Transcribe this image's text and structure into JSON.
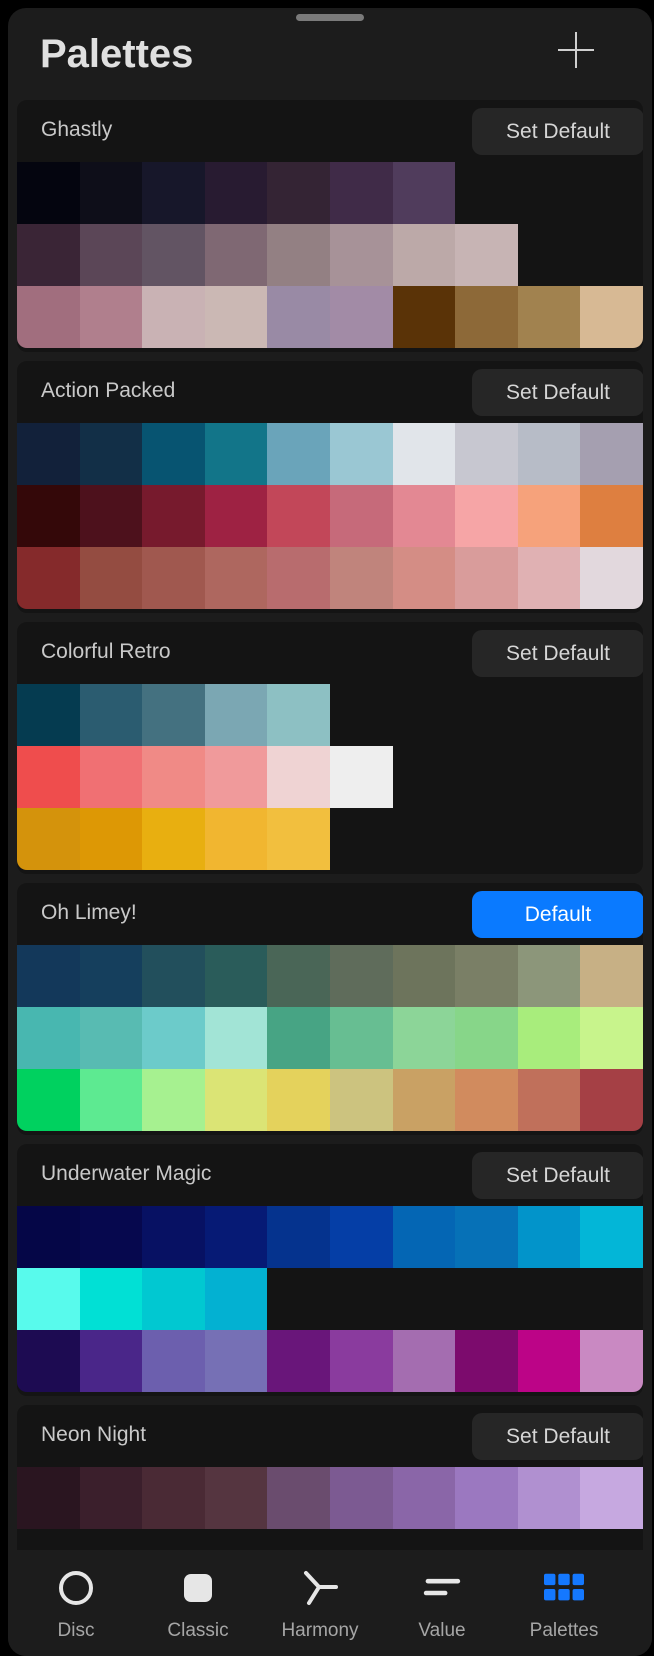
{
  "header": {
    "title": "Palettes",
    "add_icon": "plus-icon"
  },
  "palettes": [
    {
      "name": "Ghastly",
      "button": "Set Default",
      "is_default": false,
      "rows": [
        [
          "#04050f",
          "#0e0e19",
          "#17172a",
          "#281b31",
          "#342434",
          "#402b48",
          "#503c5c"
        ],
        [
          "#3a2536",
          "#5b4657",
          "#625463",
          "#7f6873",
          "#938083",
          "#a79298",
          "#bca9a8",
          "#c7b4b4"
        ],
        [
          "#a16e7e",
          "#b07f8d",
          "#c9b2b4",
          "#cbb8b4",
          "#998aa5",
          "#a28ba6",
          "#5a3307",
          "#8d6938",
          "#a1824f",
          "#d7b994"
        ]
      ]
    },
    {
      "name": "Action Packed",
      "button": "Set Default",
      "is_default": false,
      "rows": [
        [
          "#12213a",
          "#122f47",
          "#075471",
          "#127589",
          "#6aa4ba",
          "#9ac7d3",
          "#e1e5ea",
          "#c7c7d0",
          "#b7bcc7",
          "#a59fb0"
        ],
        [
          "#340809",
          "#4d111c",
          "#771a2d",
          "#9e2243",
          "#c24759",
          "#c66a7a",
          "#e38893",
          "#f6a5a6",
          "#f6a27b",
          "#de7f40"
        ],
        [
          "#852a2b",
          "#944c41",
          "#a0584f",
          "#ae675f",
          "#b86c6e",
          "#c0847c",
          "#d48d85",
          "#d99c9b",
          "#e0b1b3",
          "#e2d8dd"
        ]
      ]
    },
    {
      "name": "Colorful Retro",
      "button": "Set Default",
      "is_default": false,
      "rows": [
        [
          "#053b50",
          "#2b5c70",
          "#447180",
          "#7ba7b3",
          "#8dc0c3"
        ],
        [
          "#ef4d4d",
          "#f07073",
          "#f08a86",
          "#f09a9b",
          "#efd3d3",
          "#eeeeee"
        ],
        [
          "#d4930c",
          "#dd9805",
          "#e8af10",
          "#f1b630",
          "#f2bf3e"
        ]
      ]
    },
    {
      "name": "Oh Limey!",
      "button": "Default",
      "is_default": true,
      "rows": [
        [
          "#13385a",
          "#153f5d",
          "#224f5c",
          "#2a5c5a",
          "#4a6657",
          "#5f6c5b",
          "#6d745c",
          "#7a7f66",
          "#8c967a",
          "#c7b085"
        ],
        [
          "#48b7b0",
          "#58bbb2",
          "#6ccbca",
          "#a2e4d6",
          "#47a484",
          "#67be92",
          "#8cd598",
          "#87d689",
          "#a8ed7c",
          "#c8f48c"
        ],
        [
          "#00d15f",
          "#5dea91",
          "#a6f190",
          "#dbe475",
          "#e4d25c",
          "#ccc37f",
          "#c9a164",
          "#d18b5e",
          "#c0705b",
          "#a54045"
        ]
      ]
    },
    {
      "name": "Underwater Magic",
      "button": "Set Default",
      "is_default": false,
      "rows": [
        [
          "#050647",
          "#06084e",
          "#071163",
          "#061a75",
          "#05338e",
          "#053ea6",
          "#0466b4",
          "#0671b7",
          "#0294ca",
          "#03b6d7"
        ],
        [
          "#58faec",
          "#01e0d5",
          "#01c8d1",
          "#03b1d2"
        ],
        [
          "#1d0b52",
          "#4a2689",
          "#6c5fae",
          "#7670b5",
          "#69167a",
          "#8a3b9e",
          "#a46db0",
          "#7c0b6d",
          "#bc0487",
          "#c989c2"
        ]
      ]
    },
    {
      "name": "Neon Night",
      "button": "Set Default",
      "is_default": false,
      "rows": [
        [
          "#2a1520",
          "#3b1f2c",
          "#4a2a35",
          "#553540",
          "#6a4c6e",
          "#7c5a92",
          "#8a66a8",
          "#9b78c0",
          "#b090d0",
          "#c6a8e0"
        ],
        [],
        []
      ]
    }
  ],
  "tabs": [
    {
      "label": "Disc",
      "icon": "disc-icon"
    },
    {
      "label": "Classic",
      "icon": "classic-square-icon"
    },
    {
      "label": "Harmony",
      "icon": "harmony-icon"
    },
    {
      "label": "Value",
      "icon": "value-bars-icon"
    },
    {
      "label": "Palettes",
      "icon": "palettes-grid-icon",
      "active": true
    }
  ],
  "accent_color": "#0a7aff"
}
